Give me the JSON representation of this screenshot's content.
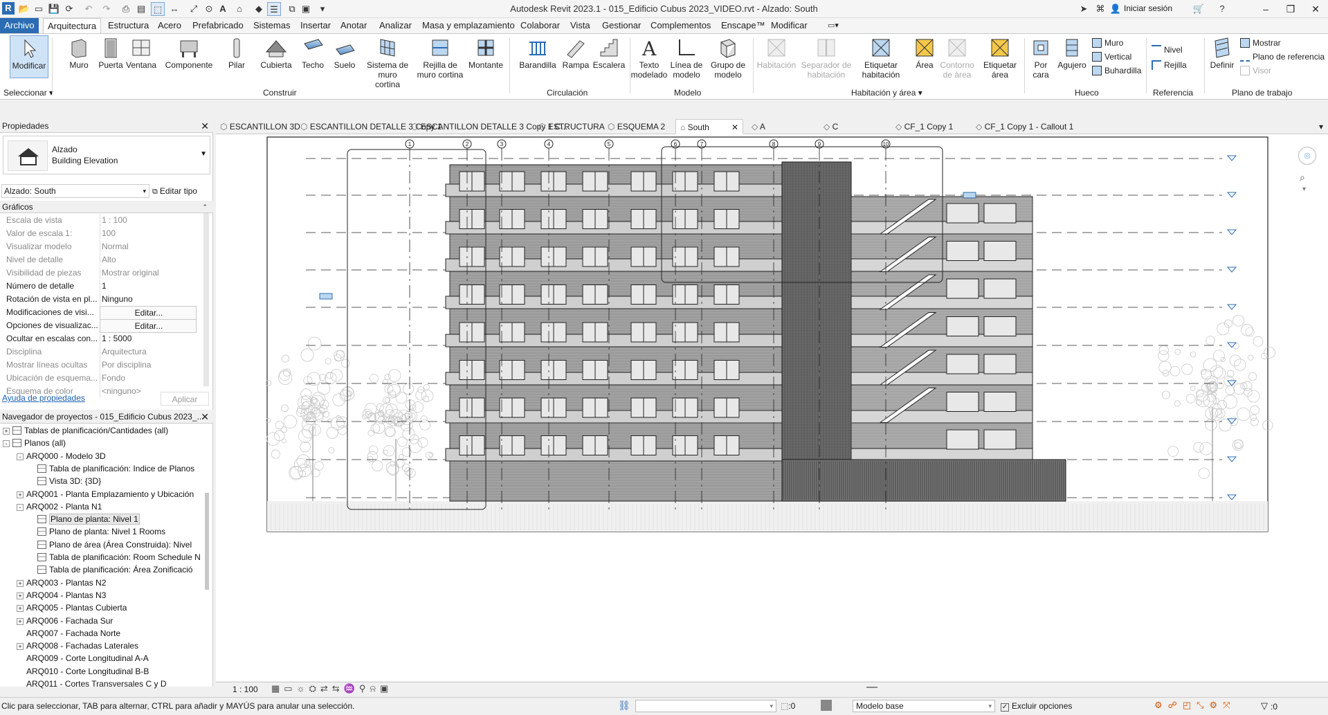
{
  "app": {
    "title": "Autodesk Revit 2023.1 - 015_Edificio Cubus 2023_VIDEO.rvt - Alzado: South",
    "signin": "Iniciar sesión"
  },
  "ribbon_tabs": [
    "Archivo",
    "Arquitectura",
    "Estructura",
    "Acero",
    "Prefabricado",
    "Sistemas",
    "Insertar",
    "Anotar",
    "Analizar",
    "Masa y emplazamiento",
    "Colaborar",
    "Vista",
    "Gestionar",
    "Complementos",
    "Enscape™",
    "Modificar"
  ],
  "ribbon": {
    "modificar": "Modificar",
    "seleccionar": "Seleccionar",
    "construir": {
      "label": "Construir",
      "items": [
        "Muro",
        "Puerta",
        "Ventana",
        "Componente",
        "Pilar",
        "Cubierta",
        "Techo",
        "Suelo",
        "Sistema de muro cortina",
        "Rejilla de muro cortina",
        "Montante"
      ]
    },
    "circulacion": {
      "label": "Circulación",
      "items": [
        "Barandilla",
        "Rampa",
        "Escalera"
      ]
    },
    "modelo": {
      "label": "Modelo",
      "items": [
        "Texto modelado",
        "Línea de modelo",
        "Grupo de modelo"
      ]
    },
    "habitacion": {
      "label": "Habitación y área",
      "items": [
        "Habitación",
        "Separador de habitación",
        "Etiquetar habitación",
        "Área",
        "Contorno de área",
        "Etiquetar área"
      ]
    },
    "hueco": {
      "label": "Hueco",
      "items": [
        "Por cara",
        "Agujero"
      ],
      "small": [
        "Muro",
        "Vertical",
        "Buhardilla"
      ]
    },
    "referencia": {
      "label": "Referencia",
      "small": [
        "Nivel",
        "Rejilla"
      ]
    },
    "plano": {
      "label": "Plano de trabajo",
      "items": [
        "Definir"
      ],
      "small": [
        "Mostrar",
        "Plano de referencia",
        "Visor"
      ]
    }
  },
  "properties": {
    "header": "Propiedades",
    "type_name": "Alzado",
    "type_sub": "Building Elevation",
    "selector": "Alzado: South",
    "edit_type": "Editar tipo",
    "group": "Gráficos",
    "rows": [
      {
        "k": "Escala de vista",
        "v": "1 : 100",
        "dim": true
      },
      {
        "k": "Valor de escala    1:",
        "v": "100",
        "dim": true
      },
      {
        "k": "Visualizar modelo",
        "v": "Normal",
        "dim": true
      },
      {
        "k": "Nivel de detalle",
        "v": "Alto",
        "dim": true
      },
      {
        "k": "Visibilidad de piezas",
        "v": "Mostrar original",
        "dim": true
      },
      {
        "k": "Número de detalle",
        "v": "1",
        "dim": false
      },
      {
        "k": "Rotación de vista en pl...",
        "v": "Ninguno",
        "dim": false
      },
      {
        "k": "Modificaciones de visi...",
        "v": "Editar...",
        "dim": false,
        "btn": true
      },
      {
        "k": "Opciones de visualizac...",
        "v": "Editar...",
        "dim": false,
        "btn": true
      },
      {
        "k": "Ocultar en escalas con...",
        "v": "1 : 5000",
        "dim": false
      },
      {
        "k": "Disciplina",
        "v": "Arquitectura",
        "dim": true
      },
      {
        "k": "Mostrar líneas ocultas",
        "v": "Por disciplina",
        "dim": true
      },
      {
        "k": "Ubicación de esquema...",
        "v": "Fondo",
        "dim": true
      },
      {
        "k": "Esquema de color",
        "v": "<ninguno>",
        "dim": true
      }
    ],
    "help": "Ayuda de propiedades",
    "apply": "Aplicar"
  },
  "browser": {
    "header": "Navegador de proyectos - 015_Edificio Cubus 2023_...",
    "nodes": [
      {
        "t": "Tablas de planificación/Cantidades (all)",
        "lvl": 0,
        "tog": "+",
        "ico": "tbl"
      },
      {
        "t": "Planos (all)",
        "lvl": 0,
        "tog": "-",
        "ico": "sh"
      },
      {
        "t": "ARQ000 - Modelo 3D",
        "lvl": 1,
        "tog": "-"
      },
      {
        "t": "Tabla de planificación: Indice de Planos",
        "lvl": 2,
        "ico": "tbl"
      },
      {
        "t": "Vista 3D: {3D}",
        "lvl": 2,
        "ico": "3d"
      },
      {
        "t": "ARQ001 - Planta Emplazamiento y Ubicación",
        "lvl": 1,
        "tog": "+"
      },
      {
        "t": "ARQ002 - Planta N1",
        "lvl": 1,
        "tog": "-"
      },
      {
        "t": "Plano de planta: Nivel 1",
        "lvl": 2,
        "ico": "pl",
        "sel": true
      },
      {
        "t": "Plano de planta: Nivel 1 Rooms",
        "lvl": 2,
        "ico": "pl"
      },
      {
        "t": "Plano de área (Área Construida): Nivel",
        "lvl": 2,
        "ico": "pl"
      },
      {
        "t": "Tabla de planificación: Room Schedule N",
        "lvl": 2,
        "ico": "tbl"
      },
      {
        "t": "Tabla de planificación: Área Zonificació",
        "lvl": 2,
        "ico": "tbl"
      },
      {
        "t": "ARQ003 - Plantas N2",
        "lvl": 1,
        "tog": "+"
      },
      {
        "t": "ARQ004 - Plantas N3",
        "lvl": 1,
        "tog": "+"
      },
      {
        "t": "ARQ005 - Plantas Cubierta",
        "lvl": 1,
        "tog": "+"
      },
      {
        "t": "ARQ006 - Fachada Sur",
        "lvl": 1,
        "tog": "+"
      },
      {
        "t": "ARQ007 - Fachada Norte",
        "lvl": 1
      },
      {
        "t": "ARQ008 - Fachadas Laterales",
        "lvl": 1,
        "tog": "+"
      },
      {
        "t": "ARQ009 - Corte Longitudinal A-A",
        "lvl": 1
      },
      {
        "t": "ARQ010 - Corte Longitudinal B-B",
        "lvl": 1
      },
      {
        "t": "ARQ011 - Cortes Transversales C y D",
        "lvl": 1
      }
    ]
  },
  "view_tabs": [
    "ESCANTILLON 3D",
    "ESCANTILLON DETALLE 3 Copy 1",
    "ESCANTILLON DETALLE 3 Copy 1 C...",
    "ESTRUCTURA",
    "ESQUEMA 2",
    "South",
    "A",
    "C",
    "CF_1 Copy 1",
    "CF_1 Copy 1 - Callout 1"
  ],
  "grid_labels": [
    "1",
    "2",
    "3",
    "4",
    "5",
    "6",
    "7",
    "8",
    "9",
    "10"
  ],
  "view_scale": "1 : 100",
  "status": {
    "hint": "Clic para seleccionar, TAB para alternar, CTRL para añadir y MAYÚS para anular una selección.",
    "count1": ":0",
    "model": "Modelo base",
    "exclude": "Excluir opciones",
    "count2": ":0"
  }
}
